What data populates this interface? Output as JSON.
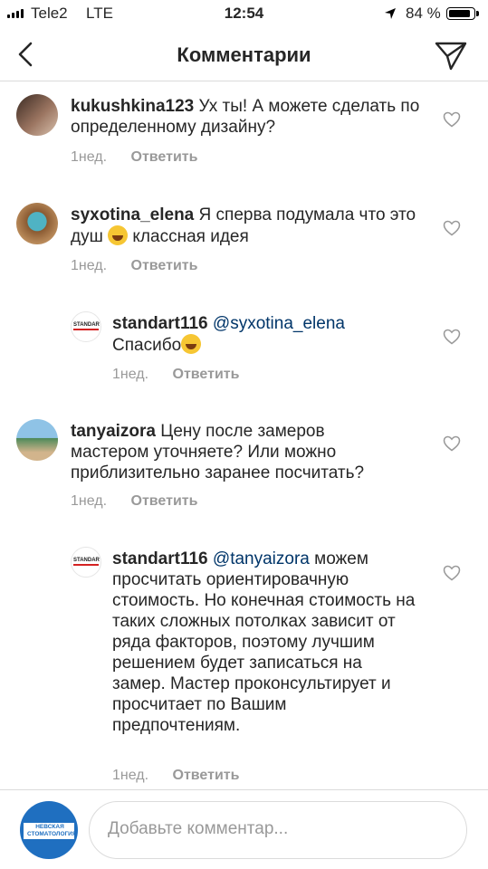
{
  "status_bar": {
    "carrier": "Tele2",
    "network": "LTE",
    "time": "12:54",
    "battery": "84 %",
    "battery_level": 0.84
  },
  "header": {
    "title": "Комментарии",
    "back_icon": "chevron-left-icon",
    "send_icon": "paper-plane-icon"
  },
  "comments": [
    {
      "user": "kukushkina123",
      "text": "Ух ты! А можете сделать по определенному дизайну?",
      "time": "1нед.",
      "reply_label": "Ответить"
    },
    {
      "user": "syxotina_elena",
      "text_before": "Я сперва подумала что это душ",
      "emoji": "laughing-emoji",
      "text_after": "классная идея",
      "time": "1нед.",
      "reply_label": "Ответить"
    },
    {
      "user": "standart116",
      "mention": "@syxotina_elena",
      "text": "Спасибо",
      "emoji": "grinning-emoji",
      "time": "1нед.",
      "reply_label": "Ответить",
      "avatar_text": "STANDART"
    },
    {
      "user": "tanyaizora",
      "text": "Цену после замеров мастером уточняете? Или можно приблизительно заранее посчитать?",
      "time": "1нед.",
      "reply_label": "Ответить"
    },
    {
      "user": "standart116",
      "mention": "@tanyaizora",
      "text": "можем просчитать ориентировачную стоимость. Но конечная стоимость на таких сложных потолках зависит от ряда факторов, поэтому лучшим решением будет записаться на замер. Мастер проконсультирует и просчитает по Вашим предпочтениям.",
      "time": "1нед.",
      "reply_label": "Ответить",
      "avatar_text": "STANDART"
    }
  ],
  "composer": {
    "placeholder": "Добавьте комментар...",
    "avatar_text": "НЕВСКАЯ СТОМАТОЛОГИЯ"
  },
  "colors": {
    "link": "#003569",
    "meta": "#999999",
    "divider": "#dbdbdb"
  }
}
